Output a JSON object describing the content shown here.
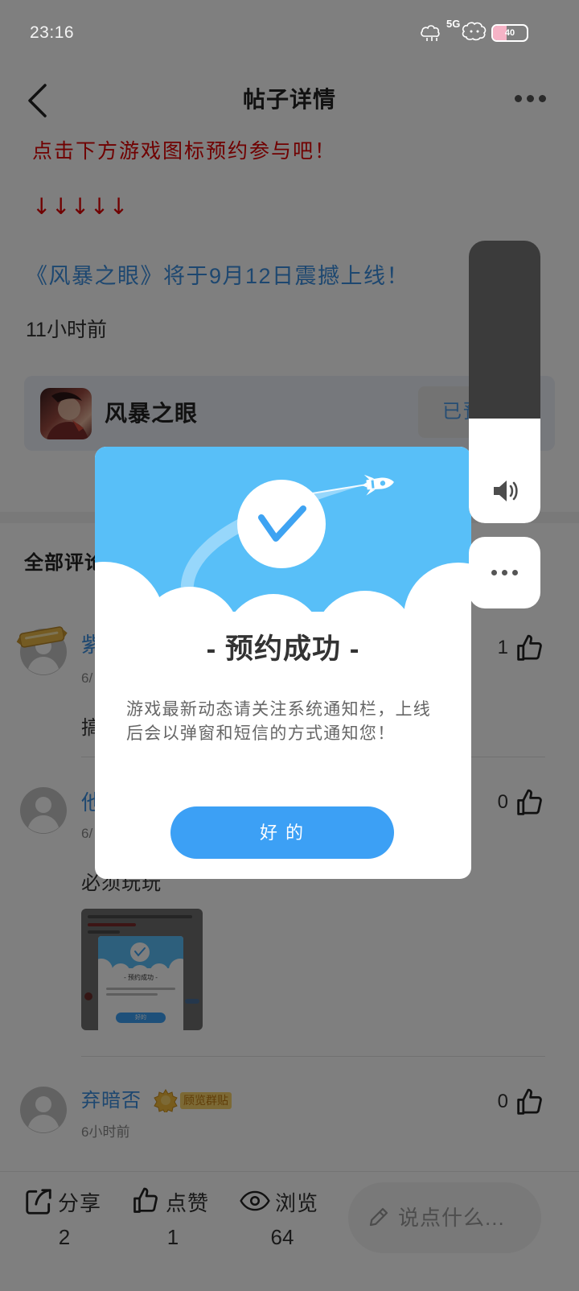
{
  "status_bar": {
    "time": "23:16",
    "network": "5G",
    "battery": "40"
  },
  "header": {
    "title": "帖子详情",
    "back_icon": "chevron-left-icon",
    "more_icon": "more-dots-icon"
  },
  "post": {
    "cta": "点击下方游戏图标预约参与吧！",
    "arrows": "↓↓↓↓↓",
    "link": "《风暴之眼》将于9月12日震撼上线！",
    "time_ago": "11小时前",
    "game": {
      "name": "风暴之眼",
      "button_label": "已预"
    }
  },
  "comments": {
    "heading": "全部评论",
    "items": [
      {
        "name": "紫",
        "date": "6/",
        "likes": "1",
        "text": "搞"
      },
      {
        "name": "他",
        "date": "6/",
        "likes": "0",
        "text": "必须玩玩",
        "image": {
          "title": "- 预约成功 -",
          "button": "好的"
        }
      },
      {
        "name": "弃暗否",
        "tag": "顾览群贴",
        "date": "6小时前",
        "likes": "0"
      }
    ]
  },
  "bottom_bar": {
    "share": {
      "label": "分享",
      "count": "2",
      "icon": "share-icon"
    },
    "like": {
      "label": "点赞",
      "count": "1",
      "icon": "thumbs-up-icon"
    },
    "view": {
      "label": "浏览",
      "count": "64",
      "icon": "eye-icon"
    },
    "input_placeholder": "说点什么..."
  },
  "modal": {
    "title": "- 预约成功 -",
    "body_lines": [
      "游戏最新动态请关注系统通知栏，上线",
      "后会以弹窗和短信的方式通知您！"
    ],
    "button": "好 的"
  },
  "volume_panel": {
    "level": 0.37,
    "icon": "speaker-icon"
  },
  "colors": {
    "red": "#e00000",
    "link_blue": "#3a8fe0",
    "modal_blue": "#58bff8",
    "button_blue": "#3ca0f5",
    "overlay": "rgba(0,0,0,0.5)"
  }
}
